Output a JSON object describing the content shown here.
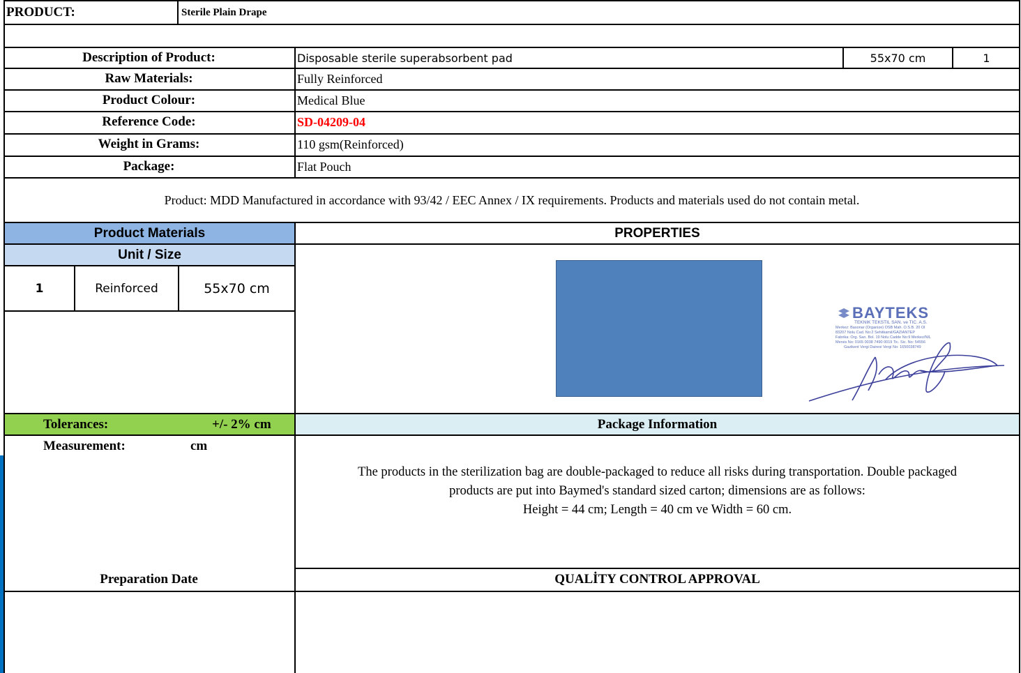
{
  "header": {
    "product_label": "PRODUCT:",
    "product_name": "Sterile Plain Drape"
  },
  "spec": {
    "rows": [
      {
        "label": "Description of Product:",
        "value": "Disposable sterile superabsorbent pad",
        "size": "55x70 cm",
        "qty": "1"
      },
      {
        "label": "Raw  Materials:",
        "value": "Fully Reinforced"
      },
      {
        "label": "Product Colour:",
        "value": "Medical Blue"
      },
      {
        "label": "Reference Code:",
        "value": "SD-04209-04"
      },
      {
        "label": "Weight in Grams:",
        "value": "110 gsm(Reinforced)"
      },
      {
        "label": "Package:",
        "value": "Flat Pouch"
      }
    ],
    "reference_color": "#ff0000"
  },
  "note": "Product: MDD Manufactured in accordance with 93/42 / EEC Annex / IX requirements. Products and materials used do not contain metal.",
  "materials": {
    "title": "Product Materials",
    "subtitle": "Unit / Size",
    "item": {
      "no": "1",
      "type": "Reinforced",
      "size": "55x70 cm"
    },
    "header_color": "#8db4e2",
    "subheader_color": "#c5d9f1"
  },
  "properties": {
    "title": "PROPERTIES",
    "swatch_color": "#4f81bd",
    "stamp": {
      "company": "BAYTEKS",
      "line1": "TEKNIK TEKSTIL SAN. ve TIC. A.S.",
      "line2": "Merkez: Basonar (Organize) OSB Mah. O.S.B. 20 Ol",
      "line3": "83207 Nolu Cad. No:2   Sehitkamil/GAZIANTEP",
      "line4": "Fabrika: Org. San. Bol. 19 Nolu Cadde No:9  Merkez/NIL",
      "line5": "Mersis No: 0165 0038 7490 0019   Tic. Sic. No: 54556",
      "line6": "Gazikent Vergi Dairesi Vergi No: 1650038749"
    }
  },
  "tolerances": {
    "label": "Tolerances:",
    "value": "+/- 2% cm",
    "color": "#92d050"
  },
  "measurement": {
    "label": "Measurement:",
    "unit": "cm"
  },
  "package_info": {
    "title": "Package Information",
    "title_color": "#daeef3",
    "text_line1": "The products in the sterilization bag are double-packaged to reduce all risks during transportation. Double packaged",
    "text_line2": "products are put into Baymed's standard sized carton; dimensions are as follows:",
    "text_line3": "Height = 44 cm; Length = 40 cm ve Width = 60 cm."
  },
  "preparation": {
    "label": "Preparation Date"
  },
  "quality": {
    "label": "QUALİTY CONTROL APPROVAL"
  },
  "accent_color": "#0070c0"
}
